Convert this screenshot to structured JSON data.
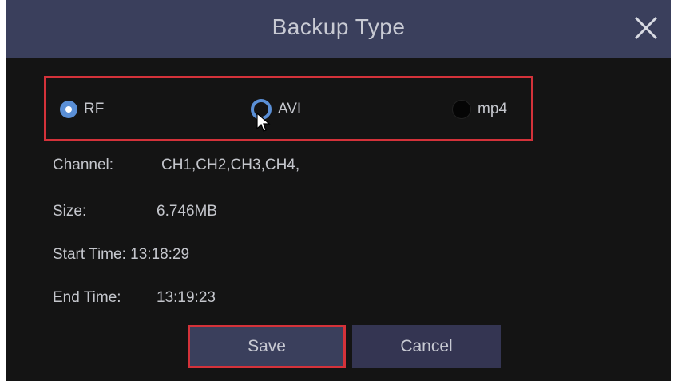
{
  "dialog": {
    "title": "Backup Type",
    "close_icon": "close-icon"
  },
  "format": {
    "options": [
      {
        "label": "RF",
        "state": "selected"
      },
      {
        "label": "AVI",
        "state": "hover"
      },
      {
        "label": "mp4",
        "state": "unselected"
      }
    ]
  },
  "info": {
    "channel_label": "Channel:",
    "channel_value": "CH1,CH2,CH3,CH4,",
    "size_label": "Size:",
    "size_value": "6.746MB",
    "start_label": "Start Time:",
    "start_value": "13:18:29",
    "end_label": "End Time:",
    "end_value": "13:19:23"
  },
  "buttons": {
    "save": "Save",
    "cancel": "Cancel"
  },
  "colors": {
    "title_bar": "#3a3f5c",
    "background": "#141414",
    "highlight_border": "#d4323a",
    "radio_accent": "#5a8fd6"
  }
}
